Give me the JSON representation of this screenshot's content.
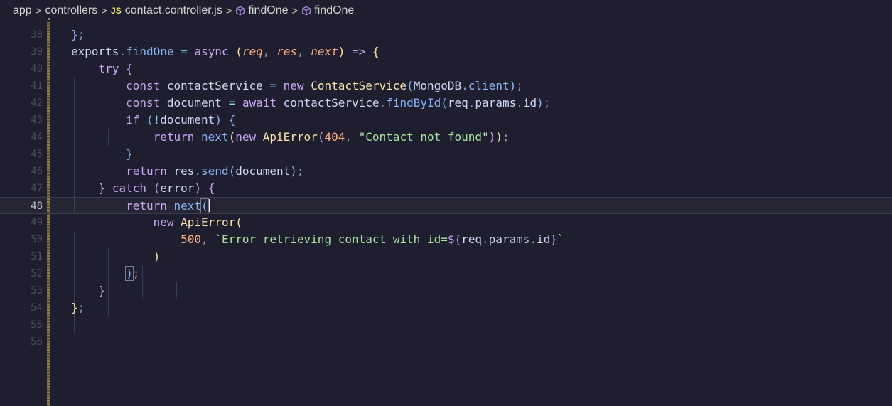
{
  "breadcrumb": {
    "items": [
      "app",
      "controllers",
      "contact.controller.js",
      "findOne",
      "findOne"
    ],
    "file_badge": "JS",
    "separator": ">"
  },
  "editor": {
    "current_line": "48",
    "lines": [
      {
        "n": "38",
        "code": "};"
      },
      {
        "n": "39",
        "code": "exports.findOne = async (req, res, next) => {"
      },
      {
        "n": "40",
        "code": "    try {"
      },
      {
        "n": "41",
        "code": "        const contactService = new ContactService(MongoDB.client);"
      },
      {
        "n": "42",
        "code": "        const document = await contactService.findById(req.params.id);"
      },
      {
        "n": "43",
        "code": "        if (!document) {"
      },
      {
        "n": "44",
        "code": "            return next(new ApiError(404, \"Contact not found\"));"
      },
      {
        "n": "45",
        "code": "        }"
      },
      {
        "n": "46",
        "code": "        return res.send(document);"
      },
      {
        "n": "47",
        "code": "    } catch (error) {"
      },
      {
        "n": "48",
        "code": "        return next("
      },
      {
        "n": "49",
        "code": "            new ApiError("
      },
      {
        "n": "50",
        "code": "                500, `Error retrieving contact with id=${req.params.id}`"
      },
      {
        "n": "51",
        "code": "            )"
      },
      {
        "n": "52",
        "code": "        );"
      },
      {
        "n": "53",
        "code": "    }"
      },
      {
        "n": "54",
        "code": "};"
      },
      {
        "n": "55",
        "code": ""
      },
      {
        "n": "56",
        "code": ""
      }
    ]
  },
  "colors": {
    "background": "#1e1e2e",
    "keyword": "#cba6f7",
    "function": "#89b4fa",
    "parameter": "#f5a97f",
    "string": "#a6e3a1",
    "number": "#fab387",
    "class": "#f9e2af"
  }
}
